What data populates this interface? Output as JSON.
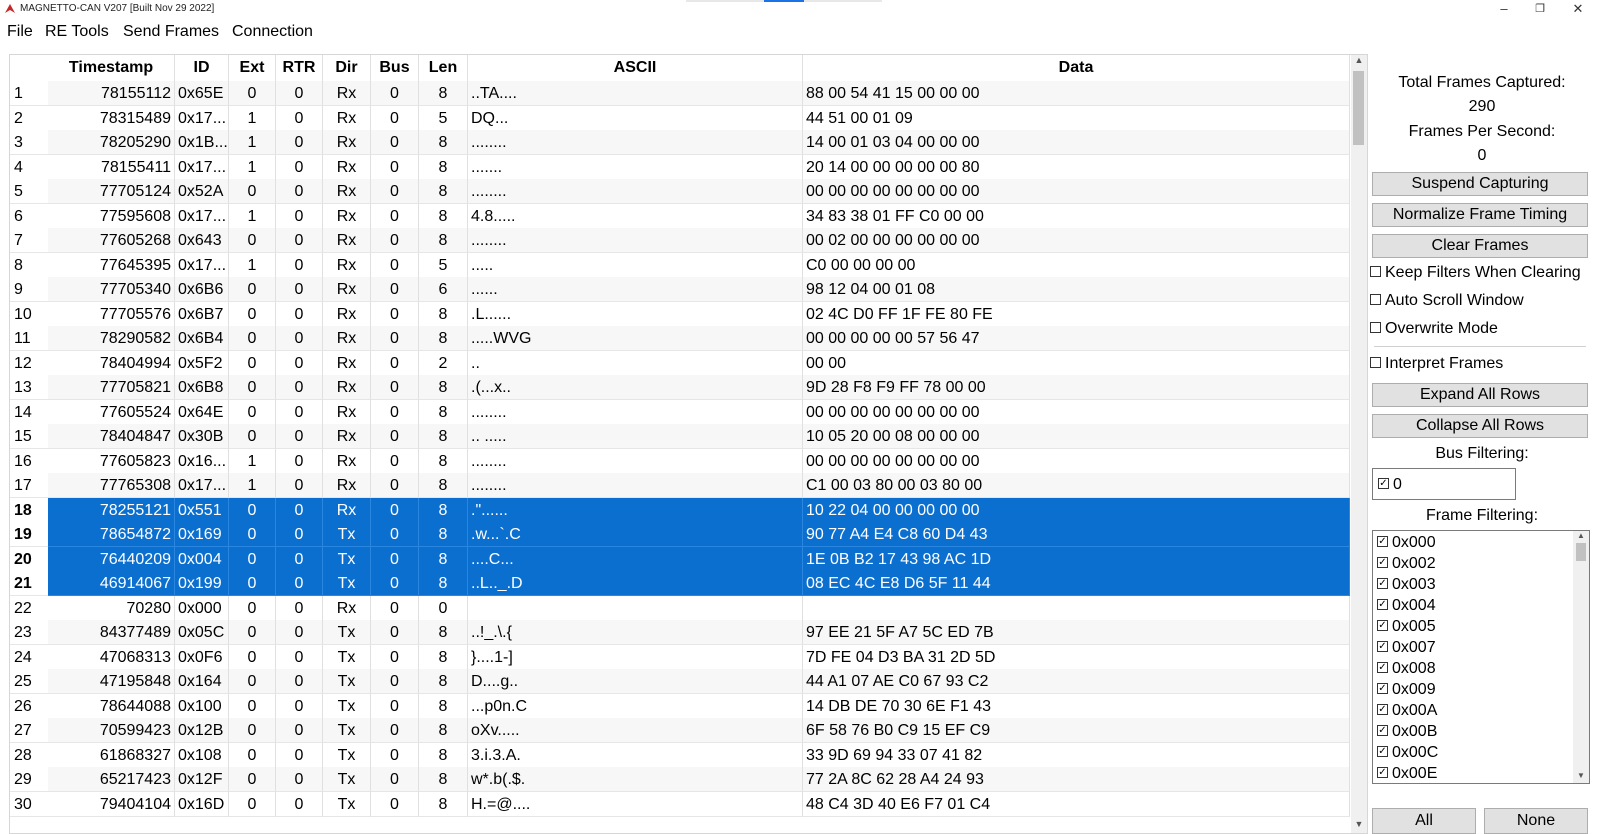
{
  "window": {
    "title": "MAGNETTO-CAN V207 [Built Nov 29 2022]",
    "minimize": "–",
    "restore": "❐",
    "close": "✕"
  },
  "menu": [
    "File",
    "RE Tools",
    "Send Frames",
    "Connection"
  ],
  "colors": {
    "selection": "#0b6fd0",
    "accent": "#c62828"
  },
  "table": {
    "columns": [
      "Timestamp",
      "ID",
      "Ext",
      "RTR",
      "Dir",
      "Bus",
      "Len",
      "ASCII",
      "Data"
    ],
    "rows": [
      [
        "1",
        "78155112",
        "0x65E",
        "0",
        "0",
        "Rx",
        "0",
        "8",
        "..TA....",
        "88 00 54 41 15 00 00 00"
      ],
      [
        "2",
        "78315489",
        "0x17...",
        "1",
        "0",
        "Rx",
        "0",
        "5",
        "DQ...",
        "44 51 00 01 09"
      ],
      [
        "3",
        "78205290",
        "0x1B...",
        "1",
        "0",
        "Rx",
        "0",
        "8",
        "........",
        "14 00 01 03 04 00 00 00"
      ],
      [
        "4",
        "78155411",
        "0x17...",
        "1",
        "0",
        "Rx",
        "0",
        "8",
        " .......",
        "20 14 00 00 00 00 00 80"
      ],
      [
        "5",
        "77705124",
        "0x52A",
        "0",
        "0",
        "Rx",
        "0",
        "8",
        "........",
        "00 00 00 00 00 00 00 00"
      ],
      [
        "6",
        "77595608",
        "0x17...",
        "1",
        "0",
        "Rx",
        "0",
        "8",
        "4.8.....",
        "34 83 38 01 FF C0 00 00"
      ],
      [
        "7",
        "77605268",
        "0x643",
        "0",
        "0",
        "Rx",
        "0",
        "8",
        "........",
        "00 02 00 00 00 00 00 00"
      ],
      [
        "8",
        "77645395",
        "0x17...",
        "1",
        "0",
        "Rx",
        "0",
        "5",
        ".....",
        "C0 00 00 00 00"
      ],
      [
        "9",
        "77705340",
        "0x6B6",
        "0",
        "0",
        "Rx",
        "0",
        "6",
        "......",
        "98 12 04 00 01 08"
      ],
      [
        "10",
        "77705576",
        "0x6B7",
        "0",
        "0",
        "Rx",
        "0",
        "8",
        ".L......",
        "02 4C D0 FF 1F FE 80 FE"
      ],
      [
        "11",
        "78290582",
        "0x6B4",
        "0",
        "0",
        "Rx",
        "0",
        "8",
        ".....WVG",
        "00 00 00 00 00 57 56 47"
      ],
      [
        "12",
        "78404994",
        "0x5F2",
        "0",
        "0",
        "Rx",
        "0",
        "2",
        "..",
        "00 00"
      ],
      [
        "13",
        "77705821",
        "0x6B8",
        "0",
        "0",
        "Rx",
        "0",
        "8",
        ".(...x..",
        "9D 28 F8 F9 FF 78 00 00"
      ],
      [
        "14",
        "77605524",
        "0x64E",
        "0",
        "0",
        "Rx",
        "0",
        "8",
        "........",
        "00 00 00 00 00 00 00 00"
      ],
      [
        "15",
        "78404847",
        "0x30B",
        "0",
        "0",
        "Rx",
        "0",
        "8",
        ".. .....",
        "10 05 20 00 08 00 00 00"
      ],
      [
        "16",
        "77605823",
        "0x16...",
        "1",
        "0",
        "Rx",
        "0",
        "8",
        "........",
        "00 00 00 00 00 00 00 00"
      ],
      [
        "17",
        "77765308",
        "0x17...",
        "1",
        "0",
        "Rx",
        "0",
        "8",
        "........",
        "C1 00 03 80 00 03 80 00"
      ],
      [
        "18",
        "78255121",
        "0x551",
        "0",
        "0",
        "Rx",
        "0",
        "8",
        ".\"......",
        "10 22 04 00 00 00 00 00"
      ],
      [
        "19",
        "78654872",
        "0x169",
        "0",
        "0",
        "Tx",
        "0",
        "8",
        ".w...`.C",
        "90 77 A4 E4 C8 60 D4 43"
      ],
      [
        "20",
        "76440209",
        "0x004",
        "0",
        "0",
        "Tx",
        "0",
        "8",
        "....C...",
        "1E 0B B2 17 43 98 AC 1D"
      ],
      [
        "21",
        "46914067",
        "0x199",
        "0",
        "0",
        "Tx",
        "0",
        "8",
        "..L.._.D",
        "08 EC 4C E8 D6 5F 11 44"
      ],
      [
        "22",
        "70280",
        "0x000",
        "0",
        "0",
        "Rx",
        "0",
        "0",
        "",
        ""
      ],
      [
        "23",
        "84377489",
        "0x05C",
        "0",
        "0",
        "Tx",
        "0",
        "8",
        "..!_.\\.{",
        "97 EE 21 5F A7 5C ED 7B"
      ],
      [
        "24",
        "47068313",
        "0x0F6",
        "0",
        "0",
        "Tx",
        "0",
        "8",
        "}....1-]",
        "7D FE 04 D3 BA 31 2D 5D"
      ],
      [
        "25",
        "47195848",
        "0x164",
        "0",
        "0",
        "Tx",
        "0",
        "8",
        "D....g..",
        "44 A1 07 AE C0 67 93 C2"
      ],
      [
        "26",
        "78644088",
        "0x100",
        "0",
        "0",
        "Tx",
        "0",
        "8",
        "...p0n.C",
        "14 DB DE 70 30 6E F1 43"
      ],
      [
        "27",
        "70599423",
        "0x12B",
        "0",
        "0",
        "Tx",
        "0",
        "8",
        "oXv.....",
        "6F 58 76 B0 C9 15 EF C9"
      ],
      [
        "28",
        "61868327",
        "0x108",
        "0",
        "0",
        "Tx",
        "0",
        "8",
        "3.i.3.A.",
        "33 9D 69 94 33 07 41 82"
      ],
      [
        "29",
        "65217423",
        "0x12F",
        "0",
        "0",
        "Tx",
        "0",
        "8",
        "w*.b(.$.",
        "77 2A 8C 62 28 A4 24 93"
      ],
      [
        "30",
        "79404104",
        "0x16D",
        "0",
        "0",
        "Tx",
        "0",
        "8",
        "H.=@....",
        "48 C4 3D 40 E6 F7 01 C4"
      ]
    ],
    "selected_rows": [
      "18",
      "19",
      "20",
      "21"
    ]
  },
  "side": {
    "total_frames_label": "Total Frames Captured:",
    "total_frames_value": "290",
    "fps_label": "Frames Per Second:",
    "fps_value": "0",
    "suspend_button": "Suspend Capturing",
    "normalize_button": "Normalize Frame Timing",
    "clear_button": "Clear Frames",
    "keep_filters": "Keep Filters When Clearing",
    "auto_scroll": "Auto Scroll Window",
    "overwrite_mode": "Overwrite Mode",
    "interpret_frames": "Interpret Frames",
    "expand_button": "Expand All Rows",
    "collapse_button": "Collapse All Rows",
    "bus_filtering_label": "Bus Filtering:",
    "bus_filter_item": "0",
    "frame_filtering_label": "Frame Filtering:",
    "frame_filters": [
      "0x000",
      "0x002",
      "0x003",
      "0x004",
      "0x005",
      "0x007",
      "0x008",
      "0x009",
      "0x00A",
      "0x00B",
      "0x00C",
      "0x00E"
    ],
    "all_button": "All",
    "none_button": "None"
  }
}
